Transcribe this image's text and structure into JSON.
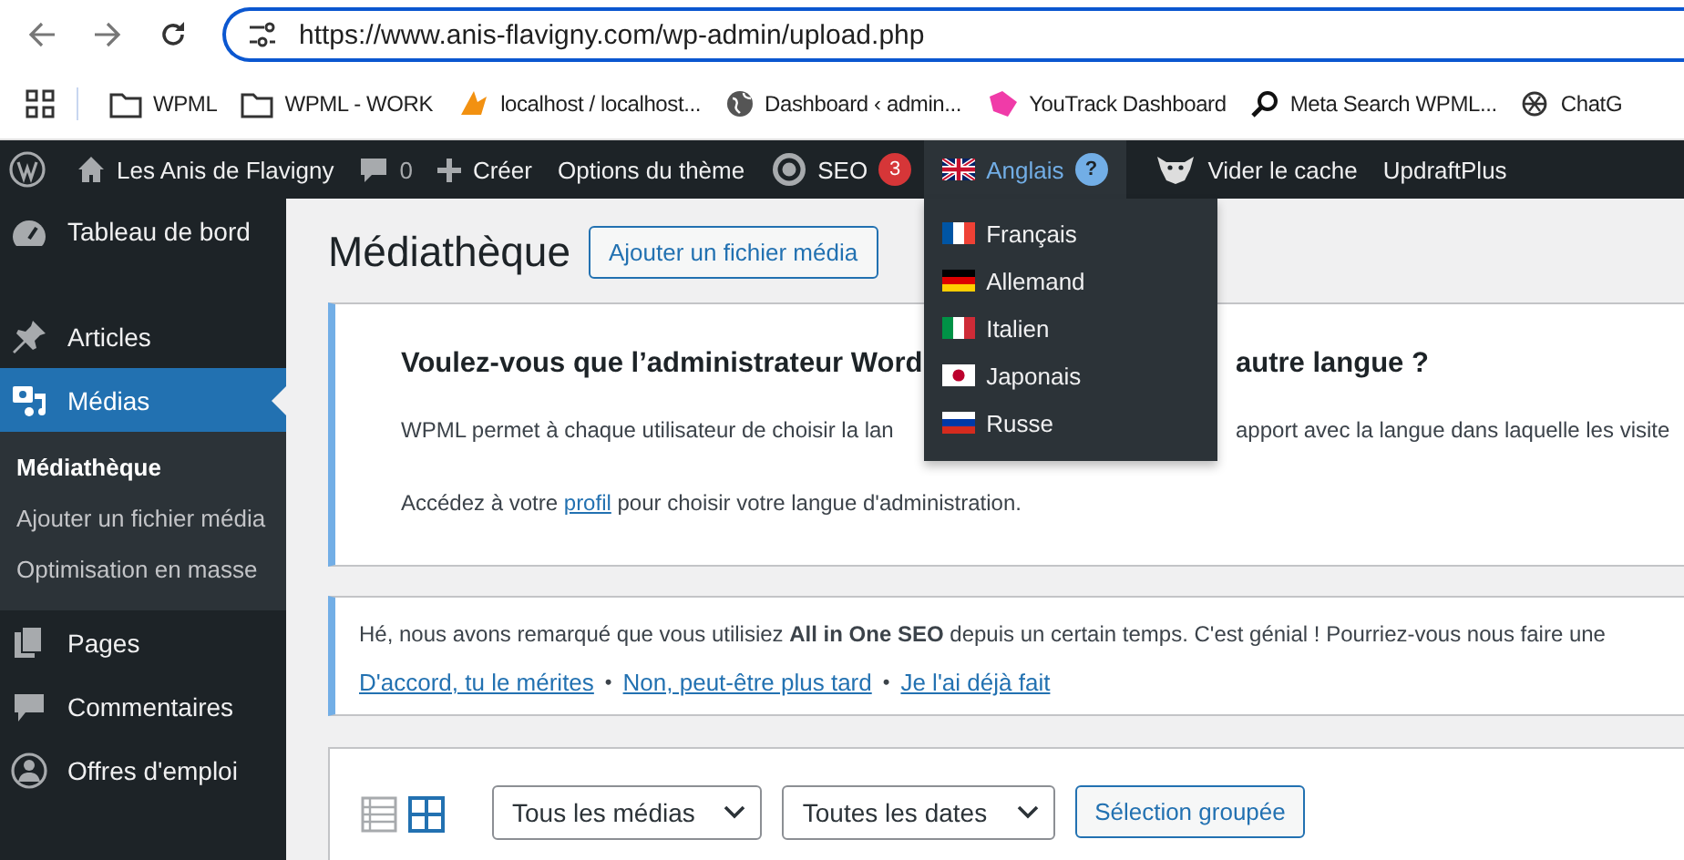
{
  "browser": {
    "url": "https://www.anis-flavigny.com/wp-admin/upload.php",
    "bookmarks": [
      {
        "kind": "folder",
        "label": "WPML"
      },
      {
        "kind": "folder",
        "label": "WPML - WORK"
      },
      {
        "kind": "pma",
        "label": "localhost / localhost..."
      },
      {
        "kind": "globe",
        "label": "Dashboard ‹ admin..."
      },
      {
        "kind": "youtrack",
        "label": "YouTrack Dashboard"
      },
      {
        "kind": "search",
        "label": "Meta Search WPML..."
      },
      {
        "kind": "knot",
        "label": "ChatG"
      }
    ]
  },
  "admin_bar": [
    {
      "kind": "logo"
    },
    {
      "kind": "home",
      "label": "Les Anis de Flavigny"
    },
    {
      "kind": "comments",
      "label": "0"
    },
    {
      "kind": "new",
      "label": "Créer"
    },
    {
      "kind": "text",
      "label": "Options du thème"
    },
    {
      "kind": "seo",
      "label": "SEO",
      "badge": "3"
    },
    {
      "kind": "language",
      "label": "Anglais",
      "badge": "?",
      "expanded": true
    },
    {
      "kind": "cache",
      "label": "Vider le cache"
    },
    {
      "kind": "text",
      "label": "UpdraftPlus"
    }
  ],
  "language_menu": [
    {
      "kind": "fr",
      "label": "Français"
    },
    {
      "kind": "de",
      "label": "Allemand"
    },
    {
      "kind": "it",
      "label": "Italien"
    },
    {
      "kind": "jp",
      "label": "Japonais"
    },
    {
      "kind": "ru",
      "label": "Russe"
    }
  ],
  "sidebar": {
    "items": [
      {
        "kind": "dashboard",
        "label": "Tableau de bord",
        "selected": false
      },
      {
        "kind": "pin",
        "label": "Articles",
        "selected": false
      },
      {
        "kind": "media",
        "label": "Médias",
        "selected": true,
        "children": [
          {
            "label": "Médiathèque",
            "selected": true
          },
          {
            "label": "Ajouter un fichier média",
            "selected": false
          },
          {
            "label": "Optimisation en masse",
            "selected": false
          }
        ]
      },
      {
        "kind": "pages",
        "label": "Pages",
        "selected": false
      },
      {
        "kind": "comment",
        "label": "Commentaires",
        "selected": false
      },
      {
        "kind": "person",
        "label": "Offres d'emploi",
        "selected": false
      }
    ]
  },
  "page": {
    "title": "Médiathèque",
    "add_button": "Ajouter un fichier média"
  },
  "language_notice": {
    "title_parts": [
      "Voulez-vous que l’administrateur Word",
      "autre langue ?"
    ],
    "line_parts": [
      "WPML permet à chaque utilisateur de choisir la lan",
      "apport avec la langue dans laquelle les visite"
    ],
    "profile_before": "Accédez à votre ",
    "profile_link": "profil",
    "profile_after": " pour choisir votre langue d'administration."
  },
  "review_notice": {
    "text": "Hé, nous avons remarqué que vous utilisiez **All in One SEO** depuis un certain temps. C'est génial ! Pourriez-vous nous faire une",
    "actions": [
      {
        "kind": "link",
        "text": "D'accord, tu le mérites "
      },
      {
        "kind": "separator",
        "text": "•"
      },
      {
        "kind": "link",
        "text": "Non, peut-être plus tard "
      },
      {
        "kind": "separator",
        "text": "•"
      },
      {
        "kind": "link",
        "text": "Je l'ai déjà fait"
      }
    ]
  },
  "toolbar": {
    "views": [
      {
        "kind": "list",
        "selected": false
      },
      {
        "kind": "grid",
        "selected": true
      }
    ],
    "filters": [
      "Tous les médias",
      "Toutes les dates"
    ],
    "bulk_button": "Sélection groupée"
  }
}
